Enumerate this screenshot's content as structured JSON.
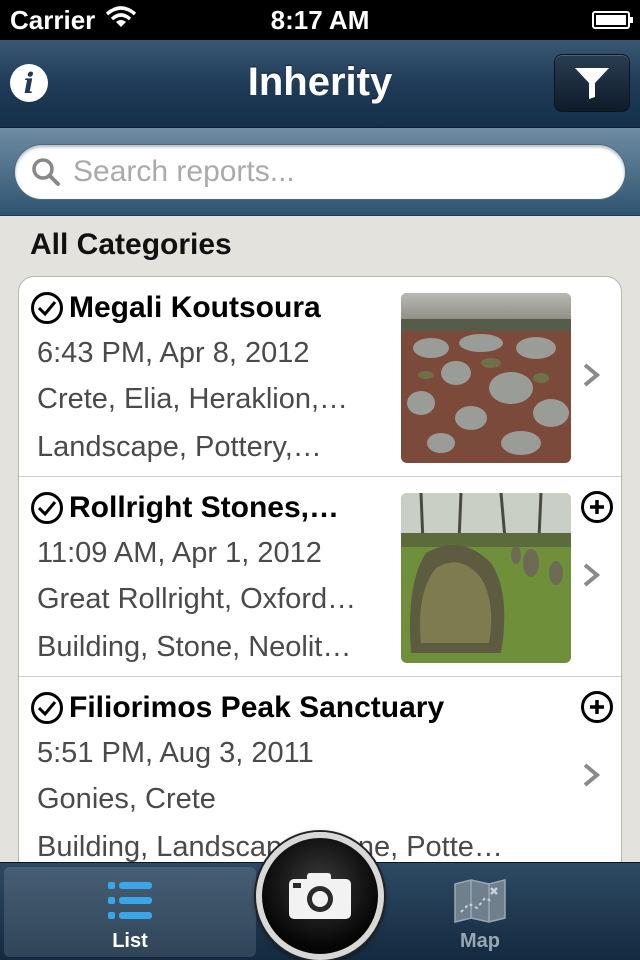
{
  "status_bar": {
    "carrier": "Carrier",
    "time": "8:17 AM"
  },
  "nav": {
    "title": "Inherity",
    "info_icon": "info-icon",
    "filter_icon": "filter-icon"
  },
  "search": {
    "placeholder": "Search reports..."
  },
  "section": {
    "title": "All Categories"
  },
  "reports": [
    {
      "title": "Megali Koutsoura",
      "date": "6:43 PM, Apr 8, 2012",
      "location": "Crete, Elia, Heraklion,…",
      "tags": "Landscape, Pottery,…",
      "has_thumbnail": true,
      "has_plus": false
    },
    {
      "title": "Rollright Stones,…",
      "date": "11:09 AM, Apr 1, 2012",
      "location": "Great Rollright, Oxford…",
      "tags": "Building, Stone, Neolit…",
      "has_thumbnail": true,
      "has_plus": true
    },
    {
      "title": "Filiorimos Peak Sanctuary",
      "date": "5:51 PM, Aug 3, 2011",
      "location": "Gonies, Crete",
      "tags": "Building, Landscape, Stone, Potte…",
      "has_thumbnail": false,
      "has_plus": true
    }
  ],
  "tabs": [
    {
      "label": "List",
      "icon": "list-icon",
      "active": true
    },
    {
      "label": "Map",
      "icon": "map-icon",
      "active": false
    }
  ],
  "camera": {
    "icon": "camera-icon"
  }
}
